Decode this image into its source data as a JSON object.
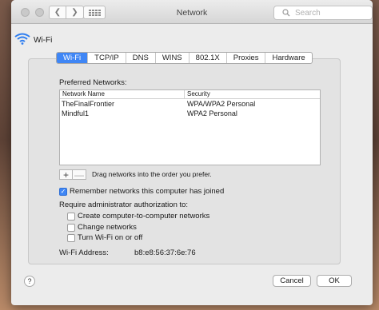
{
  "window": {
    "title": "Network"
  },
  "search": {
    "placeholder": "Search"
  },
  "interface": {
    "name": "Wi-Fi"
  },
  "tabs": [
    {
      "label": "Wi-Fi",
      "active": true
    },
    {
      "label": "TCP/IP"
    },
    {
      "label": "DNS"
    },
    {
      "label": "WINS"
    },
    {
      "label": "802.1X"
    },
    {
      "label": "Proxies"
    },
    {
      "label": "Hardware"
    }
  ],
  "preferred": {
    "label": "Preferred Networks:",
    "columns": [
      "Network Name",
      "Security"
    ],
    "rows": [
      {
        "name": "TheFinalFrontier",
        "security": "WPA/WPA2 Personal"
      },
      {
        "name": "Mindful1",
        "security": "WPA2 Personal"
      }
    ],
    "add_label": "+",
    "remove_label": "—",
    "hint": "Drag networks into the order you prefer."
  },
  "options": {
    "remember": {
      "label": "Remember networks this computer has joined",
      "checked": true
    },
    "admin_heading": "Require administrator authorization to:",
    "admin": [
      {
        "label": "Create computer-to-computer networks",
        "checked": false
      },
      {
        "label": "Change networks",
        "checked": false
      },
      {
        "label": "Turn Wi-Fi on or off",
        "checked": false
      }
    ]
  },
  "address": {
    "label": "Wi-Fi Address:",
    "value": "b8:e8:56:37:6e:76"
  },
  "buttons": {
    "help": "?",
    "cancel": "Cancel",
    "ok": "OK"
  },
  "colors": {
    "accent": "#3f86f5"
  }
}
